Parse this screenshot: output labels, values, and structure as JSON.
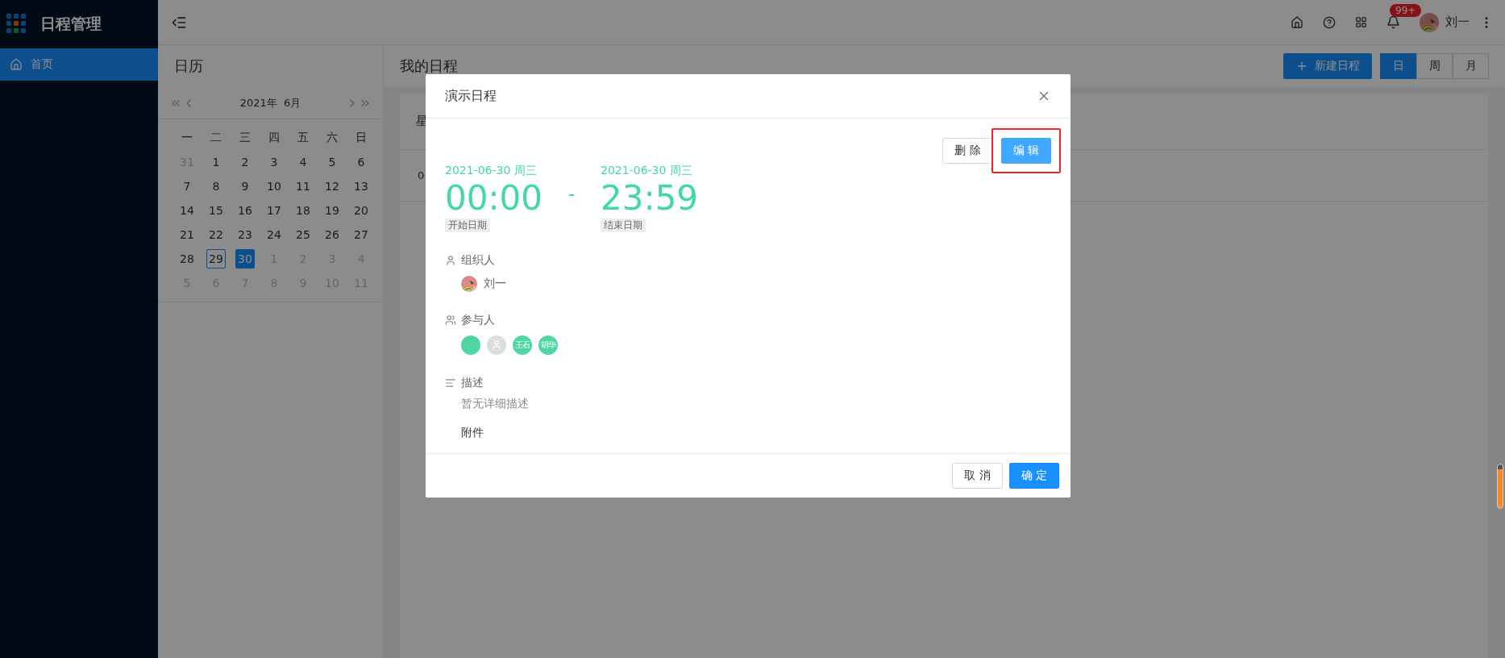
{
  "app": {
    "title": "日程管理"
  },
  "sidebar": {
    "items": [
      {
        "label": "首页",
        "selected": true
      }
    ]
  },
  "header": {
    "notification_badge": "99+",
    "user_name": "刘一"
  },
  "calendar": {
    "title": "日历",
    "month_label": "2021年  6月",
    "weekdays": [
      "一",
      "二",
      "三",
      "四",
      "五",
      "六",
      "日"
    ],
    "weeks": [
      [
        {
          "day": "31",
          "in_month": false,
          "today": false,
          "selected": false
        },
        {
          "day": "1",
          "in_month": true,
          "today": false,
          "selected": false
        },
        {
          "day": "2",
          "in_month": true,
          "today": false,
          "selected": false
        },
        {
          "day": "3",
          "in_month": true,
          "today": false,
          "selected": false
        },
        {
          "day": "4",
          "in_month": true,
          "today": false,
          "selected": false
        },
        {
          "day": "5",
          "in_month": true,
          "today": false,
          "selected": false
        },
        {
          "day": "6",
          "in_month": true,
          "today": false,
          "selected": false
        }
      ],
      [
        {
          "day": "7",
          "in_month": true,
          "today": false,
          "selected": false
        },
        {
          "day": "8",
          "in_month": true,
          "today": false,
          "selected": false
        },
        {
          "day": "9",
          "in_month": true,
          "today": false,
          "selected": false
        },
        {
          "day": "10",
          "in_month": true,
          "today": false,
          "selected": false
        },
        {
          "day": "11",
          "in_month": true,
          "today": false,
          "selected": false
        },
        {
          "day": "12",
          "in_month": true,
          "today": false,
          "selected": false
        },
        {
          "day": "13",
          "in_month": true,
          "today": false,
          "selected": false
        }
      ],
      [
        {
          "day": "14",
          "in_month": true,
          "today": false,
          "selected": false
        },
        {
          "day": "15",
          "in_month": true,
          "today": false,
          "selected": false
        },
        {
          "day": "16",
          "in_month": true,
          "today": false,
          "selected": false
        },
        {
          "day": "17",
          "in_month": true,
          "today": false,
          "selected": false
        },
        {
          "day": "18",
          "in_month": true,
          "today": false,
          "selected": false
        },
        {
          "day": "19",
          "in_month": true,
          "today": false,
          "selected": false
        },
        {
          "day": "20",
          "in_month": true,
          "today": false,
          "selected": false
        }
      ],
      [
        {
          "day": "21",
          "in_month": true,
          "today": false,
          "selected": false
        },
        {
          "day": "22",
          "in_month": true,
          "today": false,
          "selected": false
        },
        {
          "day": "23",
          "in_month": true,
          "today": false,
          "selected": false
        },
        {
          "day": "24",
          "in_month": true,
          "today": false,
          "selected": false
        },
        {
          "day": "25",
          "in_month": true,
          "today": false,
          "selected": false
        },
        {
          "day": "26",
          "in_month": true,
          "today": false,
          "selected": false
        },
        {
          "day": "27",
          "in_month": true,
          "today": false,
          "selected": false
        }
      ],
      [
        {
          "day": "28",
          "in_month": true,
          "today": false,
          "selected": false
        },
        {
          "day": "29",
          "in_month": true,
          "today": true,
          "selected": false
        },
        {
          "day": "30",
          "in_month": true,
          "today": false,
          "selected": true
        },
        {
          "day": "1",
          "in_month": false,
          "today": false,
          "selected": false
        },
        {
          "day": "2",
          "in_month": false,
          "today": false,
          "selected": false
        },
        {
          "day": "3",
          "in_month": false,
          "today": false,
          "selected": false
        },
        {
          "day": "4",
          "in_month": false,
          "today": false,
          "selected": false
        }
      ],
      [
        {
          "day": "5",
          "in_month": false,
          "today": false,
          "selected": false
        },
        {
          "day": "6",
          "in_month": false,
          "today": false,
          "selected": false
        },
        {
          "day": "7",
          "in_month": false,
          "today": false,
          "selected": false
        },
        {
          "day": "8",
          "in_month": false,
          "today": false,
          "selected": false
        },
        {
          "day": "9",
          "in_month": false,
          "today": false,
          "selected": false
        },
        {
          "day": "10",
          "in_month": false,
          "today": false,
          "selected": false
        },
        {
          "day": "11",
          "in_month": false,
          "today": false,
          "selected": false
        }
      ]
    ]
  },
  "schedule": {
    "title": "我的日程",
    "new_button": "新建日程",
    "views": [
      {
        "label": "日",
        "selected": true
      },
      {
        "label": "周",
        "selected": false
      },
      {
        "label": "月",
        "selected": false
      }
    ],
    "column_header": "星",
    "time_label": "0"
  },
  "dialog": {
    "title": "演示日程",
    "actions": [
      {
        "label": "删 除",
        "kind": "default",
        "highlighted": false
      },
      {
        "label": "编 辑",
        "kind": "primary",
        "highlighted": true
      }
    ],
    "start": {
      "date": "2021-06-30 周三",
      "time": "00:00",
      "label": "开始日期"
    },
    "separator": "-",
    "end": {
      "date": "2021-06-30 周三",
      "time": "23:59",
      "label": "结束日期"
    },
    "organizer_label": "组织人",
    "organizer": {
      "name": "刘一"
    },
    "participants_label": "参与人",
    "participants": [
      {
        "kind": "plain"
      },
      {
        "kind": "default"
      },
      {
        "kind": "initials",
        "text": "王石"
      },
      {
        "kind": "initials",
        "text": "胡华"
      }
    ],
    "description_label": "描述",
    "description": "暂无详细描述",
    "attachments_label": "附件",
    "footer_buttons": [
      {
        "label": "取 消",
        "kind": "default"
      },
      {
        "label": "确 定",
        "kind": "primary"
      }
    ]
  }
}
